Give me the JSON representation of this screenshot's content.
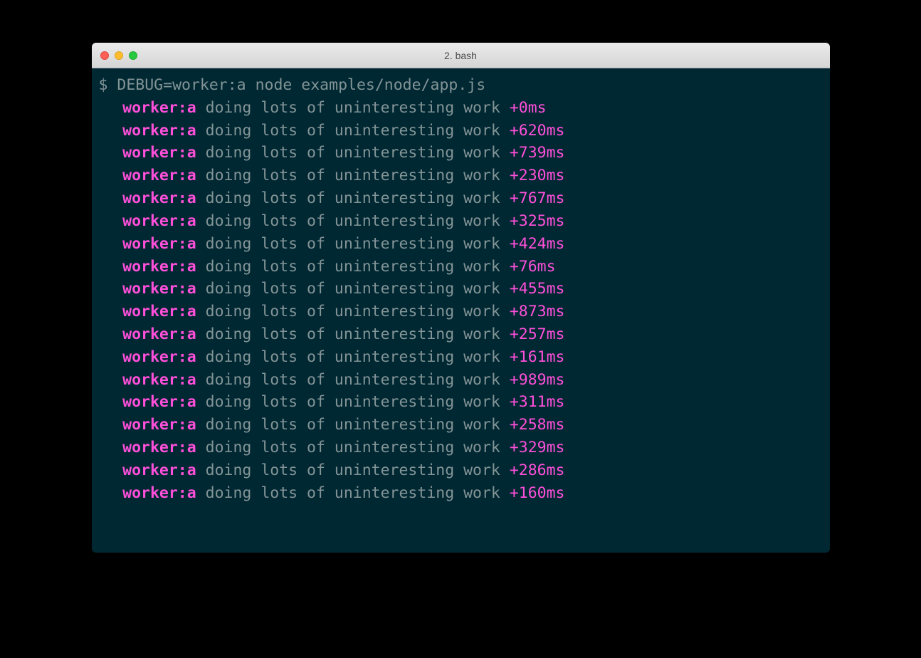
{
  "window": {
    "title": "2. bash"
  },
  "terminal": {
    "prompt": "$",
    "command": "DEBUG=worker:a node examples/node/app.js",
    "log_namespace": "worker:a",
    "log_message": "doing lots of uninteresting work",
    "entries": [
      {
        "timing": "+0ms"
      },
      {
        "timing": "+620ms"
      },
      {
        "timing": "+739ms"
      },
      {
        "timing": "+230ms"
      },
      {
        "timing": "+767ms"
      },
      {
        "timing": "+325ms"
      },
      {
        "timing": "+424ms"
      },
      {
        "timing": "+76ms"
      },
      {
        "timing": "+455ms"
      },
      {
        "timing": "+873ms"
      },
      {
        "timing": "+257ms"
      },
      {
        "timing": "+161ms"
      },
      {
        "timing": "+989ms"
      },
      {
        "timing": "+311ms"
      },
      {
        "timing": "+258ms"
      },
      {
        "timing": "+329ms"
      },
      {
        "timing": "+286ms"
      },
      {
        "timing": "+160ms"
      }
    ]
  }
}
